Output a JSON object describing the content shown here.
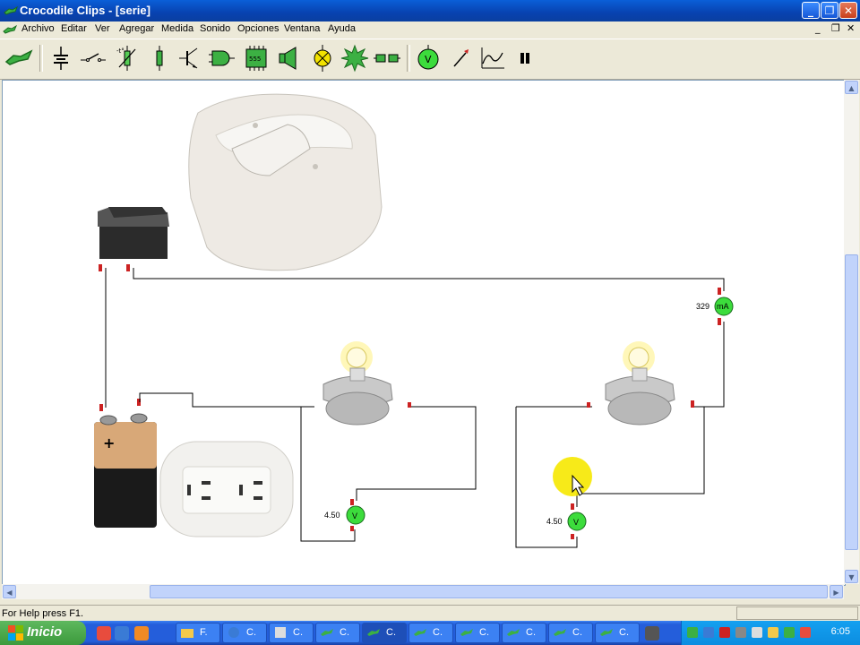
{
  "window": {
    "title": "Crocodile Clips - [serie]",
    "controls": {
      "minimize": "_",
      "restore": "❐",
      "close": "✕"
    }
  },
  "menu": {
    "items": [
      "Archivo",
      "Editar",
      "Ver",
      "Agregar",
      "Medida",
      "Sonido",
      "Opciones",
      "Ventana",
      "Ayuda"
    ]
  },
  "toolbar": {
    "buttons": [
      {
        "name": "crocodile-logo-icon"
      },
      {
        "name": "battery-component-icon"
      },
      {
        "name": "switch-component-icon"
      },
      {
        "name": "variable-resistor-icon"
      },
      {
        "name": "resistor-icon"
      },
      {
        "name": "transistor-icon"
      },
      {
        "name": "logic-gate-icon"
      },
      {
        "name": "ic-555-icon",
        "label": "555"
      },
      {
        "name": "speaker-icon"
      },
      {
        "name": "lamp-icon"
      },
      {
        "name": "burst-icon"
      },
      {
        "name": "connector-icon"
      },
      {
        "name": "voltmeter-icon",
        "label": "V"
      },
      {
        "name": "probe-icon"
      },
      {
        "name": "graph-icon"
      },
      {
        "name": "pause-icon"
      }
    ]
  },
  "circuit": {
    "ammeter": {
      "value": "329",
      "unit": "mA"
    },
    "voltmeter_left": {
      "value": "4.50",
      "unit": "V"
    },
    "voltmeter_right": {
      "value": "4.50",
      "unit": "V"
    },
    "battery_sign": "+",
    "ic_label": "555"
  },
  "status": {
    "help_text": "For Help press F1."
  },
  "taskbar": {
    "start_label": "Inicio",
    "tasks": [
      {
        "label": "F.",
        "active": false
      },
      {
        "label": "C.",
        "active": false
      },
      {
        "label": "C.",
        "active": false
      },
      {
        "label": "C.",
        "active": false
      },
      {
        "label": "C.",
        "active": true
      },
      {
        "label": "C.",
        "active": false
      },
      {
        "label": "C.",
        "active": false
      },
      {
        "label": "C.",
        "active": false
      },
      {
        "label": "C.",
        "active": false
      },
      {
        "label": "C.",
        "active": false
      }
    ],
    "clock": "6:05",
    "colors": {
      "start": "#3c9a3c",
      "bar": "#245edb",
      "tray": "#0c8de0"
    }
  }
}
